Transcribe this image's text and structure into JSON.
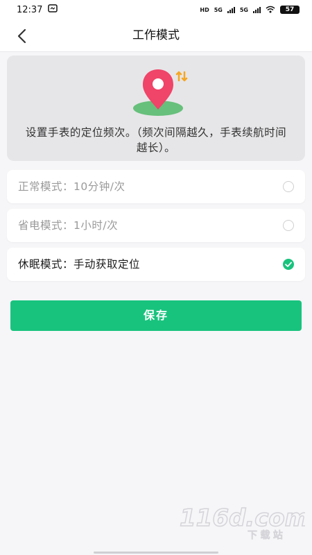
{
  "status_bar": {
    "time": "12:37",
    "network_left": "HD",
    "network_5g_1": "5G",
    "network_5g_2": "5G",
    "battery": "57"
  },
  "header": {
    "title": "工作模式"
  },
  "intro": {
    "text": "设置手表的定位频次。（频次间隔越久，手表续航时间越长）。"
  },
  "modes": [
    {
      "label": "正常模式：10分钟/次",
      "selected": false
    },
    {
      "label": "省电模式：1小时/次",
      "selected": false
    },
    {
      "label": "休眠模式：手动获取定位",
      "selected": true
    }
  ],
  "actions": {
    "save_label": "保存"
  },
  "colors": {
    "accent": "#18c37e",
    "pin": "#f04468",
    "pin_base": "#67c07b"
  },
  "icons": {
    "back": "chevron-left-icon",
    "location": "location-pin-icon",
    "check": "check-icon"
  }
}
